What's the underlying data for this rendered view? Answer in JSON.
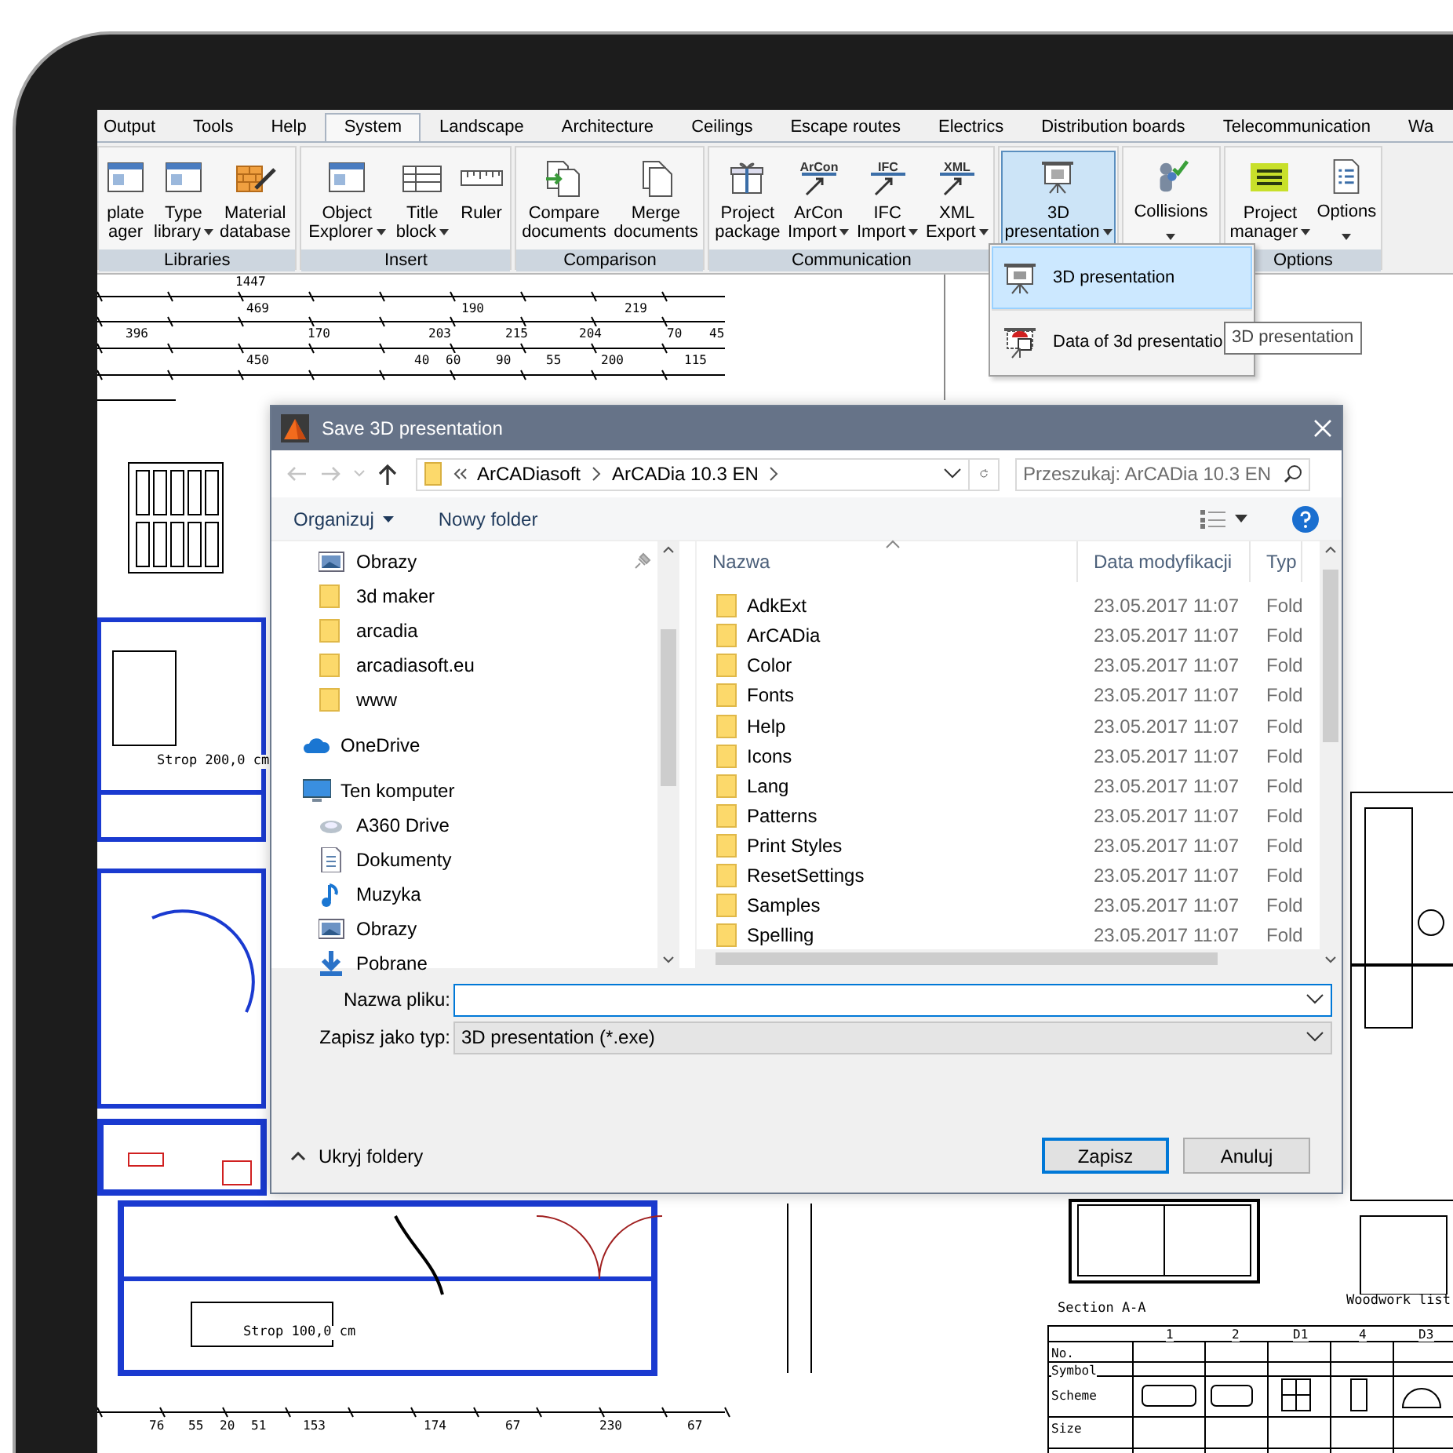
{
  "ribbon": {
    "tabs": [
      {
        "label": "Output",
        "selected": false
      },
      {
        "label": "Tools",
        "selected": false
      },
      {
        "label": "Help",
        "selected": false
      },
      {
        "label": "System",
        "selected": true
      },
      {
        "label": "Landscape",
        "selected": false
      },
      {
        "label": "Architecture",
        "selected": false
      },
      {
        "label": "Ceilings",
        "selected": false
      },
      {
        "label": "Escape routes",
        "selected": false
      },
      {
        "label": "Electrics",
        "selected": false
      },
      {
        "label": "Distribution boards",
        "selected": false
      },
      {
        "label": "Telecommunication",
        "selected": false
      },
      {
        "label": "Wa",
        "selected": false
      }
    ],
    "groups": [
      {
        "label": "Libraries",
        "buttons": [
          {
            "lines": [
              "plate",
              "ager"
            ],
            "dropdown": false,
            "pressed": false
          },
          {
            "lines": [
              "Type",
              "library"
            ],
            "dropdown": true,
            "pressed": false
          },
          {
            "lines": [
              "Material",
              "database"
            ],
            "dropdown": false,
            "pressed": false
          }
        ]
      },
      {
        "label": "Insert",
        "buttons": [
          {
            "lines": [
              "Object",
              "Explorer"
            ],
            "dropdown": true,
            "pressed": false
          },
          {
            "lines": [
              "Title",
              "block"
            ],
            "dropdown": true,
            "pressed": false
          },
          {
            "lines": [
              "Ruler"
            ],
            "dropdown": false,
            "pressed": false
          }
        ]
      },
      {
        "label": "Comparison",
        "buttons": [
          {
            "lines": [
              "Compare",
              "documents"
            ],
            "dropdown": false,
            "pressed": false
          },
          {
            "lines": [
              "Merge",
              "documents"
            ],
            "dropdown": false,
            "pressed": false
          }
        ]
      },
      {
        "label": "Communication",
        "buttons": [
          {
            "lines": [
              "Project",
              "package"
            ],
            "dropdown": false,
            "pressed": false
          },
          {
            "lines": [
              "ArCon",
              "Import"
            ],
            "dropdown": true,
            "pressed": false,
            "icon_text": "ArCon"
          },
          {
            "lines": [
              "IFC",
              "Import"
            ],
            "dropdown": true,
            "pressed": false,
            "icon_text": "IFC"
          },
          {
            "lines": [
              "XML",
              "Export"
            ],
            "dropdown": true,
            "pressed": false,
            "icon_text": "XML"
          }
        ]
      },
      {
        "buttons": [
          {
            "lines": [
              "3D",
              "presentation"
            ],
            "dropdown": true,
            "pressed": true
          }
        ]
      },
      {
        "buttons": [
          {
            "lines": [
              "Collisions"
            ],
            "dropdown": true,
            "pressed": false
          }
        ]
      },
      {
        "label": "Options",
        "buttons": [
          {
            "lines": [
              "Project",
              "manager"
            ],
            "dropdown": true,
            "pressed": false
          },
          {
            "lines": [
              "Options"
            ],
            "dropdown": true,
            "pressed": false
          }
        ]
      }
    ]
  },
  "menu": {
    "items": [
      {
        "label": "3D presentation",
        "selected": true
      },
      {
        "label": "Data of 3d presentatio",
        "selected": false
      }
    ]
  },
  "tooltip": {
    "text": "3D presentation"
  },
  "canvas": {
    "labels": [
      {
        "text": "1447",
        "kind": "dimension"
      },
      {
        "text": "469",
        "kind": "dimension"
      },
      {
        "text": "190",
        "kind": "dimension"
      },
      {
        "text": "219",
        "kind": "dimension"
      },
      {
        "text": "396",
        "kind": "dimension"
      },
      {
        "text": "170",
        "kind": "dimension"
      },
      {
        "text": "203",
        "kind": "dimension"
      },
      {
        "text": "215",
        "kind": "dimension"
      },
      {
        "text": "204",
        "kind": "dimension"
      },
      {
        "text": "70",
        "kind": "dimension"
      },
      {
        "text": "45",
        "kind": "dimension"
      },
      {
        "text": "450",
        "kind": "dimension"
      },
      {
        "text": "40",
        "kind": "dimension"
      },
      {
        "text": "60",
        "kind": "dimension"
      },
      {
        "text": "90",
        "kind": "dimension"
      },
      {
        "text": "55",
        "kind": "dimension"
      },
      {
        "text": "200",
        "kind": "dimension"
      },
      {
        "text": "115",
        "kind": "dimension"
      },
      {
        "text": "Strop 200,0 cm",
        "kind": "note"
      },
      {
        "text": "Strop 100,0 cm",
        "kind": "note"
      },
      {
        "text": "76",
        "kind": "dimension"
      },
      {
        "text": "55",
        "kind": "dimension"
      },
      {
        "text": "20",
        "kind": "dimension"
      },
      {
        "text": "51",
        "kind": "dimension"
      },
      {
        "text": "153",
        "kind": "dimension"
      },
      {
        "text": "174",
        "kind": "dimension"
      },
      {
        "text": "67",
        "kind": "dimension"
      },
      {
        "text": "230",
        "kind": "dimension"
      },
      {
        "text": "67",
        "kind": "dimension"
      },
      {
        "text": "Section A-A",
        "kind": "note"
      },
      {
        "text": "Woodwork list",
        "kind": "note"
      },
      {
        "text": "No.",
        "kind": "table"
      },
      {
        "text": "Symbol",
        "kind": "table"
      },
      {
        "text": "Scheme",
        "kind": "table"
      },
      {
        "text": "Size",
        "kind": "table"
      },
      {
        "text": "1",
        "kind": "table"
      },
      {
        "text": "2",
        "kind": "table"
      },
      {
        "text": "D1",
        "kind": "table"
      },
      {
        "text": "4",
        "kind": "table"
      },
      {
        "text": "D3",
        "kind": "table"
      }
    ]
  },
  "dialog": {
    "title": "Save 3D presentation",
    "nav": {
      "back": {
        "disabled": true
      },
      "forward": {
        "disabled": true
      },
      "up": {
        "disabled": false
      },
      "path": [
        "ArCADiasoft",
        "ArCADia 10.3 EN"
      ],
      "search": {
        "placeholder": "Przeszukaj: ArCADia 10.3 EN"
      }
    },
    "toolbar": {
      "organize": "Organizuj",
      "new_folder": "Nowy folder"
    },
    "quick_access": [
      {
        "label": "Obrazy",
        "kind": "pictures",
        "pinned": true
      },
      {
        "label": "3d maker",
        "kind": "folder",
        "pinned": false
      },
      {
        "label": "arcadia",
        "kind": "folder",
        "pinned": false
      },
      {
        "label": "arcadiasoft.eu",
        "kind": "folder",
        "pinned": false
      },
      {
        "label": "www",
        "kind": "folder",
        "pinned": false
      }
    ],
    "tree": [
      {
        "label": "OneDrive",
        "kind": "cloud"
      },
      {
        "label": "Ten komputer",
        "kind": "computer",
        "children": [
          {
            "label": "A360 Drive",
            "kind": "drive"
          },
          {
            "label": "Dokumenty",
            "kind": "documents"
          },
          {
            "label": "Muzyka",
            "kind": "music"
          },
          {
            "label": "Obrazy",
            "kind": "pictures"
          },
          {
            "label": "Pobrane",
            "kind": "downloads"
          }
        ]
      }
    ],
    "columns": [
      {
        "label": "Nazwa",
        "sorted": true
      },
      {
        "label": "Data modyfikacji",
        "sorted": false
      },
      {
        "label": "Typ",
        "sorted": false
      }
    ],
    "rows": [
      {
        "name": "AdkExt",
        "modified": "23.05.2017 11:07",
        "type": "Fold"
      },
      {
        "name": "ArCADia",
        "modified": "23.05.2017 11:07",
        "type": "Fold"
      },
      {
        "name": "Color",
        "modified": "23.05.2017 11:07",
        "type": "Fold"
      },
      {
        "name": "Fonts",
        "modified": "23.05.2017 11:07",
        "type": "Fold"
      },
      {
        "name": "Help",
        "modified": "23.05.2017 11:07",
        "type": "Fold"
      },
      {
        "name": "Icons",
        "modified": "23.05.2017 11:07",
        "type": "Fold"
      },
      {
        "name": "Lang",
        "modified": "23.05.2017 11:07",
        "type": "Fold"
      },
      {
        "name": "Patterns",
        "modified": "23.05.2017 11:07",
        "type": "Fold"
      },
      {
        "name": "Print Styles",
        "modified": "23.05.2017 11:07",
        "type": "Fold"
      },
      {
        "name": "ResetSettings",
        "modified": "23.05.2017 11:07",
        "type": "Fold"
      },
      {
        "name": "Samples",
        "modified": "23.05.2017 11:07",
        "type": "Fold"
      },
      {
        "name": "Spelling",
        "modified": "23.05.2017 11:07",
        "type": "Fold"
      }
    ],
    "file_name": {
      "label": "Nazwa pliku:",
      "focused": true
    },
    "file_type": {
      "label": "Zapisz jako typ:",
      "value": "3D presentation (*.exe)"
    },
    "hide_folders": "Ukryj foldery",
    "buttons": [
      {
        "label": "Zapisz",
        "default": true
      },
      {
        "label": "Anuluj",
        "default": false
      }
    ]
  }
}
